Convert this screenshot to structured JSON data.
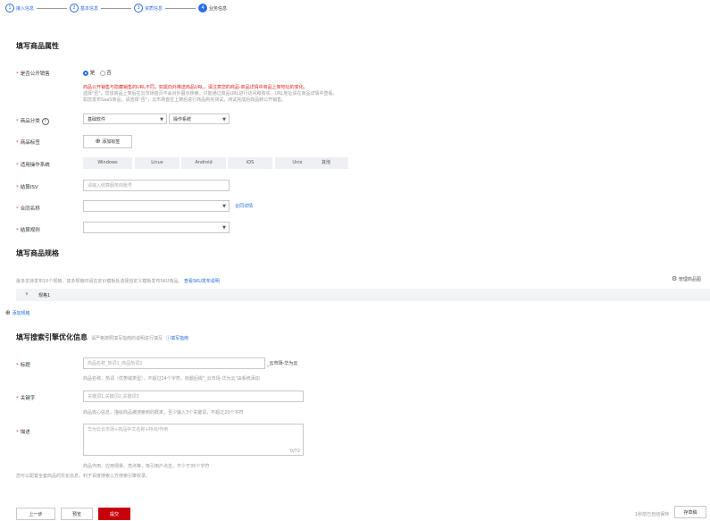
{
  "steps": [
    {
      "num": "1",
      "label": "接入信息"
    },
    {
      "num": "2",
      "label": "基本信息"
    },
    {
      "num": "3",
      "label": "资质信息"
    },
    {
      "num": "4",
      "label": "业务信息"
    }
  ],
  "section1": {
    "title": "填写商品属性",
    "public_sale": {
      "label": "是否公开销售",
      "yes": "是",
      "no": "否",
      "note1": "商品公开销售与隐藏销售的URL不同，如需向外推送商品URL，请注意您的商品-商品详情中商品上架地址的变化。",
      "note2": "选择\"否\"，您该商品上架后在云市场首页不会对外展示搜索，只能通过商品URL进行访问和购买。URL地址请在商品详情中查看。",
      "note3": "如您发布SaaS商品，请选择\"否\"，云市场首位上架后进行商品购买测试，测试完成后商品转公开销售。"
    },
    "category": {
      "label": "商品分类",
      "value1": "基础软件",
      "value2": "操作系统"
    },
    "tag": {
      "label": "商品标签",
      "button": "添加标签"
    },
    "os": {
      "label": "适用操作系统",
      "options": [
        "Windows",
        "Linux",
        "Android",
        "iOS",
        "Unix",
        "其他"
      ]
    },
    "isv": {
      "label": "结算ISV",
      "placeholder": "请输入结算服务商账号"
    },
    "contract": {
      "label": "合同名称",
      "link": "合同详情"
    },
    "settlement": {
      "label": "结算规则"
    }
  },
  "section2": {
    "title": "填写商品规格",
    "desc": "最多支持发布10个规格，如多规格时请在定价模板处选择自定义模板发布SKU商品。",
    "desc_link": "查看SKU发布说明",
    "manage": "管理商品图",
    "spec_name": "规格1",
    "add_spec": "添加规格"
  },
  "section3": {
    "title": "填写搜索引擎优化信息",
    "subtitle": "请严格按照填写指南的说明进行填写",
    "guide": "填写指南",
    "title_field": {
      "label": "标题",
      "placeholder": "商品名称_热词1_商品热词2",
      "suffix": "_云市场-华为云",
      "help": "商品名称、热词（优势或类型），不超过24个字符。标题后缀\"_云市场-华为云\"由系统添加"
    },
    "keyword": {
      "label": "关键字",
      "placeholder": "关键词1,关键词2,关键词3",
      "help": "商品核心信息，描绘商品被搜索到的概率，至少输入3个关键词，不超过20个字符"
    },
    "desc": {
      "label": "描述",
      "placeholder": "华为云云市场+商品中文名称+特点/作用",
      "counter": "0/72",
      "help": "商品作用、应用场景、亮点等，吸引用户点击，不少于35个字符"
    },
    "footer_note": "您可以配置全套商品的优化信息，利于百度搜索三方搜索引擎收录。"
  },
  "footer": {
    "prev": "上一步",
    "preview": "预览",
    "submit": "提交",
    "draft": "存草稿",
    "saved": "1秒前已自动保存"
  }
}
